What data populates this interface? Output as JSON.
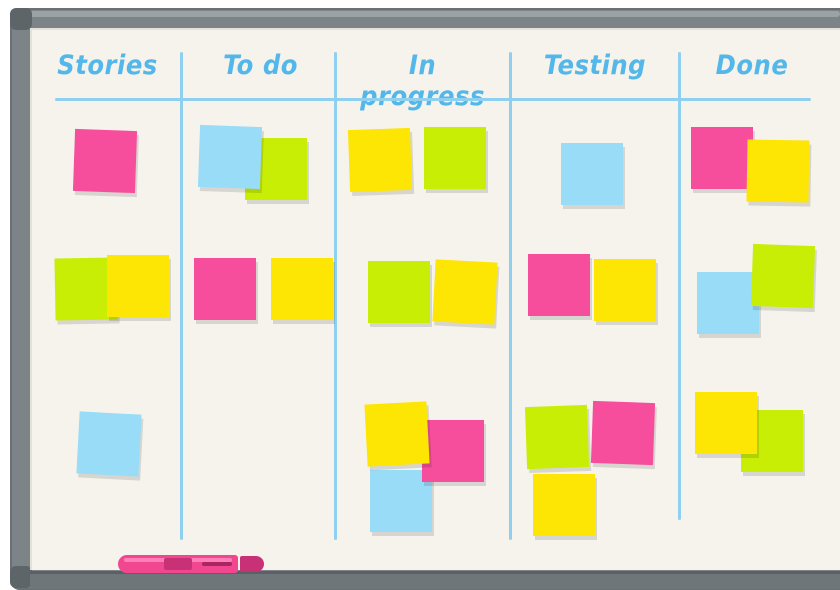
{
  "board": {
    "columns": [
      {
        "label": "Stories"
      },
      {
        "label": "To do"
      },
      {
        "label": "In progress"
      },
      {
        "label": "Testing"
      },
      {
        "label": "Done"
      }
    ]
  },
  "colors": {
    "header_text": "#54b7ea",
    "lines": "#8fd0f0",
    "pink": "#f64e9c",
    "yellow": "#fde504",
    "green": "#c8ee06",
    "blue": "#99dcf7",
    "marker": "#f14791",
    "frame": "#7d8487",
    "surface": "#f5f3ec"
  }
}
